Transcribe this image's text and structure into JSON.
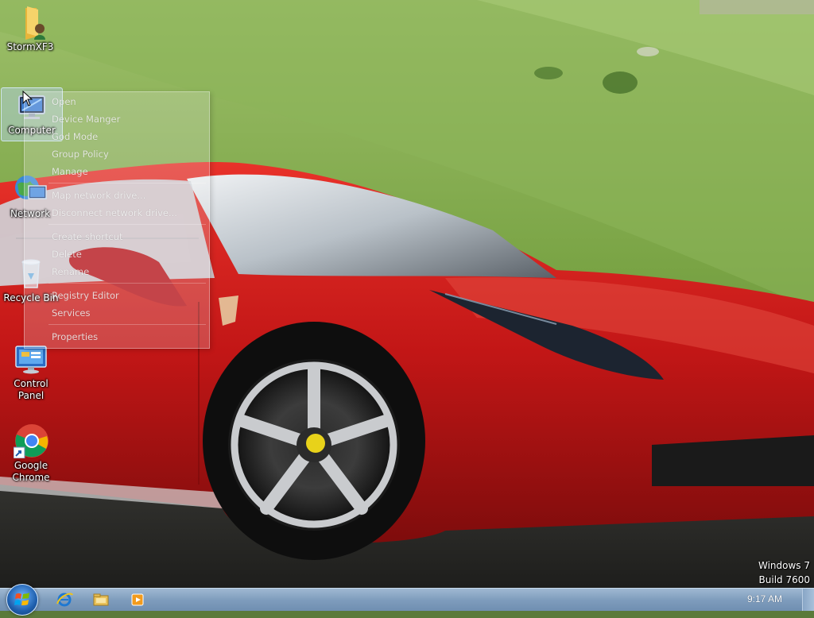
{
  "desktop": {
    "icons": [
      {
        "label": "StormXF3",
        "icon": "user-folder-icon"
      },
      {
        "label": "Computer",
        "icon": "computer-icon"
      },
      {
        "label": "Network",
        "icon": "network-icon"
      },
      {
        "label": "Recycle Bin",
        "icon": "recycle-bin-icon"
      },
      {
        "label": "Control Panel",
        "icon": "control-panel-icon"
      },
      {
        "label": "Google Chrome",
        "icon": "chrome-icon",
        "shortcut": true
      }
    ],
    "selected": "Computer"
  },
  "context_menu": {
    "items": [
      "Open",
      "Device Manger",
      "God Mode",
      "Group Policy",
      "Manage",
      "Map network drive...",
      "Disconnect network drive...",
      "Create shortcut",
      "Delete",
      "Rename",
      "Registry Editor",
      "Services",
      "Properties"
    ]
  },
  "watermark": {
    "line1": "Windows 7",
    "line2": "Build 7600"
  },
  "taskbar": {
    "pinned": [
      "internet-explorer-icon",
      "windows-explorer-icon",
      "media-player-icon"
    ],
    "clock": "9:17 AM"
  },
  "colors": {
    "taskbar": "#7f9dbd",
    "car_red": "#c81a1a",
    "hill_green": "#6f9a3e"
  }
}
